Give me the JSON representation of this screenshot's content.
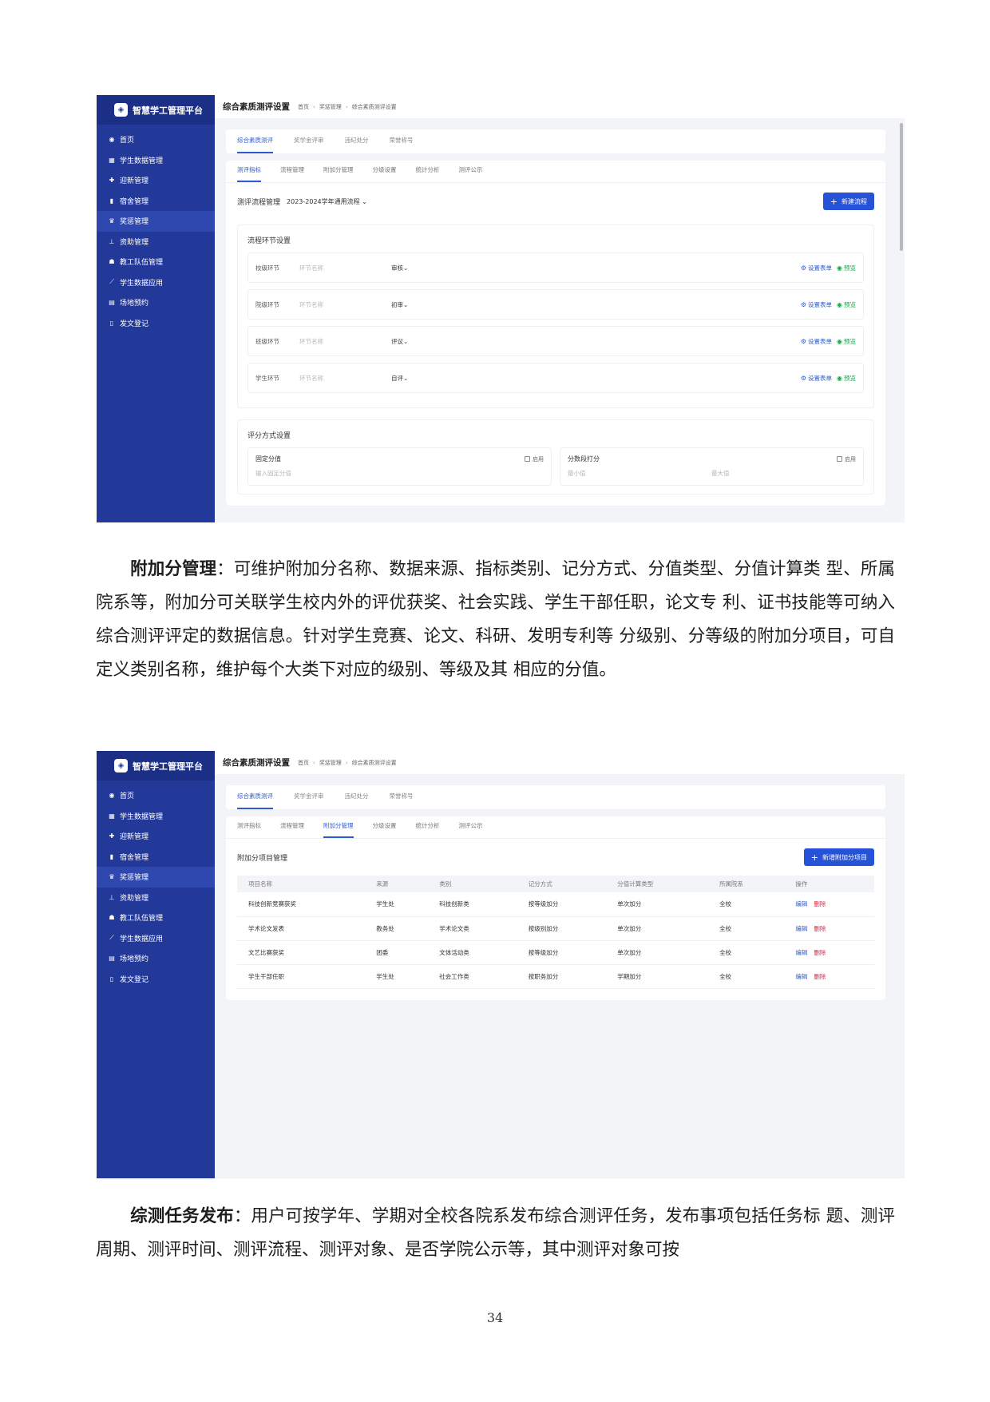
{
  "app": {
    "brand": "智慧学工管理平台",
    "nav": [
      {
        "icon": "dashboard-icon",
        "glyph": "◉",
        "label": "首页"
      },
      {
        "icon": "student-data-icon",
        "glyph": "▦",
        "label": "学生数据管理"
      },
      {
        "icon": "welcome-icon",
        "glyph": "✚",
        "label": "迎新管理"
      },
      {
        "icon": "dorm-icon",
        "glyph": "▮",
        "label": "宿舍管理"
      },
      {
        "icon": "award-icon",
        "glyph": "♛",
        "label": "奖惩管理",
        "active": true
      },
      {
        "icon": "aid-icon",
        "glyph": "⊥",
        "label": "资助管理"
      },
      {
        "icon": "team-icon",
        "glyph": "☗",
        "label": "教工队伍管理"
      },
      {
        "icon": "chart-icon",
        "glyph": "⟋",
        "label": "学生数据应用"
      },
      {
        "icon": "calendar-icon",
        "glyph": "▤",
        "label": "场地预约"
      },
      {
        "icon": "document-icon",
        "glyph": "▯",
        "label": "发文登记"
      }
    ],
    "page_title": "综合素质测评设置",
    "breadcrumb": [
      "首页",
      "奖惩管理",
      "综合素质测评设置"
    ],
    "top_tabs": [
      "综合素质测评",
      "奖学金评审",
      "违纪处分",
      "荣誉称号"
    ],
    "sub_tabs": [
      "测评指标",
      "流程管理",
      "附加分管理",
      "分级设置",
      "统计分析",
      "测评公示"
    ]
  },
  "screen1": {
    "flow_label": "测评流程管理",
    "flow_select": "2023-2024学年通用流程",
    "new_button": "新建流程",
    "stage_section_title": "流程环节设置",
    "stages": [
      {
        "name": "校级环节",
        "placeholder": "环节名称",
        "type": "审核"
      },
      {
        "name": "院级环节",
        "placeholder": "环节名称",
        "type": "初审"
      },
      {
        "name": "班级环节",
        "placeholder": "环节名称",
        "type": "评议"
      },
      {
        "name": "学生环节",
        "placeholder": "环节名称",
        "type": "自评"
      }
    ],
    "set_form": "设置表单",
    "preview": "预览",
    "score_section_title": "评分方式设置",
    "score_cards": [
      {
        "title": "固定分值",
        "check": "启用",
        "fields": [
          "输入固定分值"
        ]
      },
      {
        "title": "分数段打分",
        "check": "启用",
        "fields": [
          "最小值",
          "最大值"
        ]
      }
    ]
  },
  "screen2": {
    "table_title": "附加分项目管理",
    "new_button": "新增附加分项目",
    "columns": [
      "项目名称",
      "来源",
      "类别",
      "记分方式",
      "分值计算类型",
      "所属院系",
      "操作"
    ],
    "rows": [
      [
        "科技创新竞赛获奖",
        "学生处",
        "科技创新类",
        "按等级加分",
        "单次加分",
        "全校"
      ],
      [
        "学术论文发表",
        "教务处",
        "学术论文类",
        "按级别加分",
        "单次加分",
        "全校"
      ],
      [
        "文艺比赛获奖",
        "团委",
        "文体活动类",
        "按等级加分",
        "单次加分",
        "全校"
      ],
      [
        "学生干部任职",
        "学生处",
        "社会工作类",
        "按职务加分",
        "学期加分",
        "全校"
      ]
    ],
    "edit": "编辑",
    "delete": "删除"
  },
  "text": {
    "p1_lead": "附加分管理",
    "p1_body": "：可维护附加分名称、数据来源、指标类别、记分方式、分值类型、分值计算类 型、所属院系等，附加分可关联学生校内外的评优获奖、社会实践、学生干部任职，论文专 利、证书技能等可纳入综合测评评定的数据信息。针对学生竞赛、论文、科研、发明专利等 分级别、分等级的附加分项目，可自定义类别名称，维护每个大类下对应的级别、等级及其 相应的分值。",
    "p2_lead": "综测任务发布",
    "p2_body": "：用户可按学年、学期对全校各院系发布综合测评任务，发布事项包括任务标 题、测评周期、测评时间、测评流程、测评对象、是否学院公示等，其中测评对象可按",
    "page_number": "34"
  },
  "colors": {
    "sidebar": "#23399a",
    "primary": "#2552d6",
    "danger": "#e11d48",
    "success": "#16a34a"
  }
}
